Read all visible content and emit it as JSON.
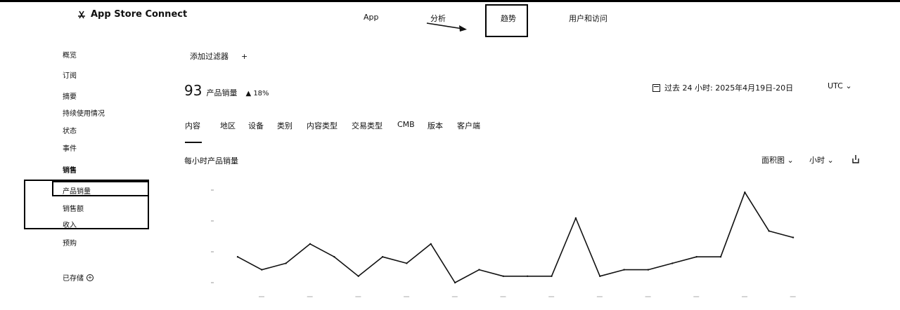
{
  "header": {
    "app_name": "App Store Connect",
    "nav": [
      "App",
      "分析",
      "趋势",
      "用户和访问"
    ]
  },
  "sidebar": {
    "items": [
      {
        "label": "概览",
        "heading": false
      },
      {
        "label": "订阅",
        "heading": false
      },
      {
        "label": "摘要",
        "heading": false
      },
      {
        "label": "持续使用情况",
        "heading": false
      },
      {
        "label": "状态",
        "heading": false
      },
      {
        "label": "事件",
        "heading": false
      },
      {
        "label": "销售",
        "heading": true
      },
      {
        "label": "产品销量",
        "heading": false
      },
      {
        "label": "销售额",
        "heading": false
      },
      {
        "label": "收入",
        "heading": false
      },
      {
        "label": "预购",
        "heading": false
      }
    ],
    "saved_label": "已存储"
  },
  "filter": {
    "add_label": "添加过滤器",
    "add_icon": "plus-icon"
  },
  "summary": {
    "value": "93",
    "label": "产品销量",
    "delta": "▲ 18%",
    "date_range": "过去 24 小时: 2025年4月19日-20日",
    "timezone": "UTC"
  },
  "tabs": [
    "内容",
    "地区",
    "设备",
    "类别",
    "内容类型",
    "交易类型",
    "CMB",
    "版本",
    "客户端"
  ],
  "chart_header": {
    "title": "每小时产品销量",
    "chart_type": "面积图",
    "granularity": "小时"
  },
  "chart_data": {
    "type": "line",
    "title": "每小时产品销量",
    "values": [
      4,
      2,
      3,
      6,
      4,
      1,
      4,
      3,
      6,
      0,
      2,
      1,
      1,
      1,
      10,
      1,
      2,
      2,
      3,
      4,
      4,
      14,
      8,
      7
    ],
    "ylim": [
      0,
      15
    ],
    "grid": false,
    "legend": "none",
    "color": "#111111"
  }
}
